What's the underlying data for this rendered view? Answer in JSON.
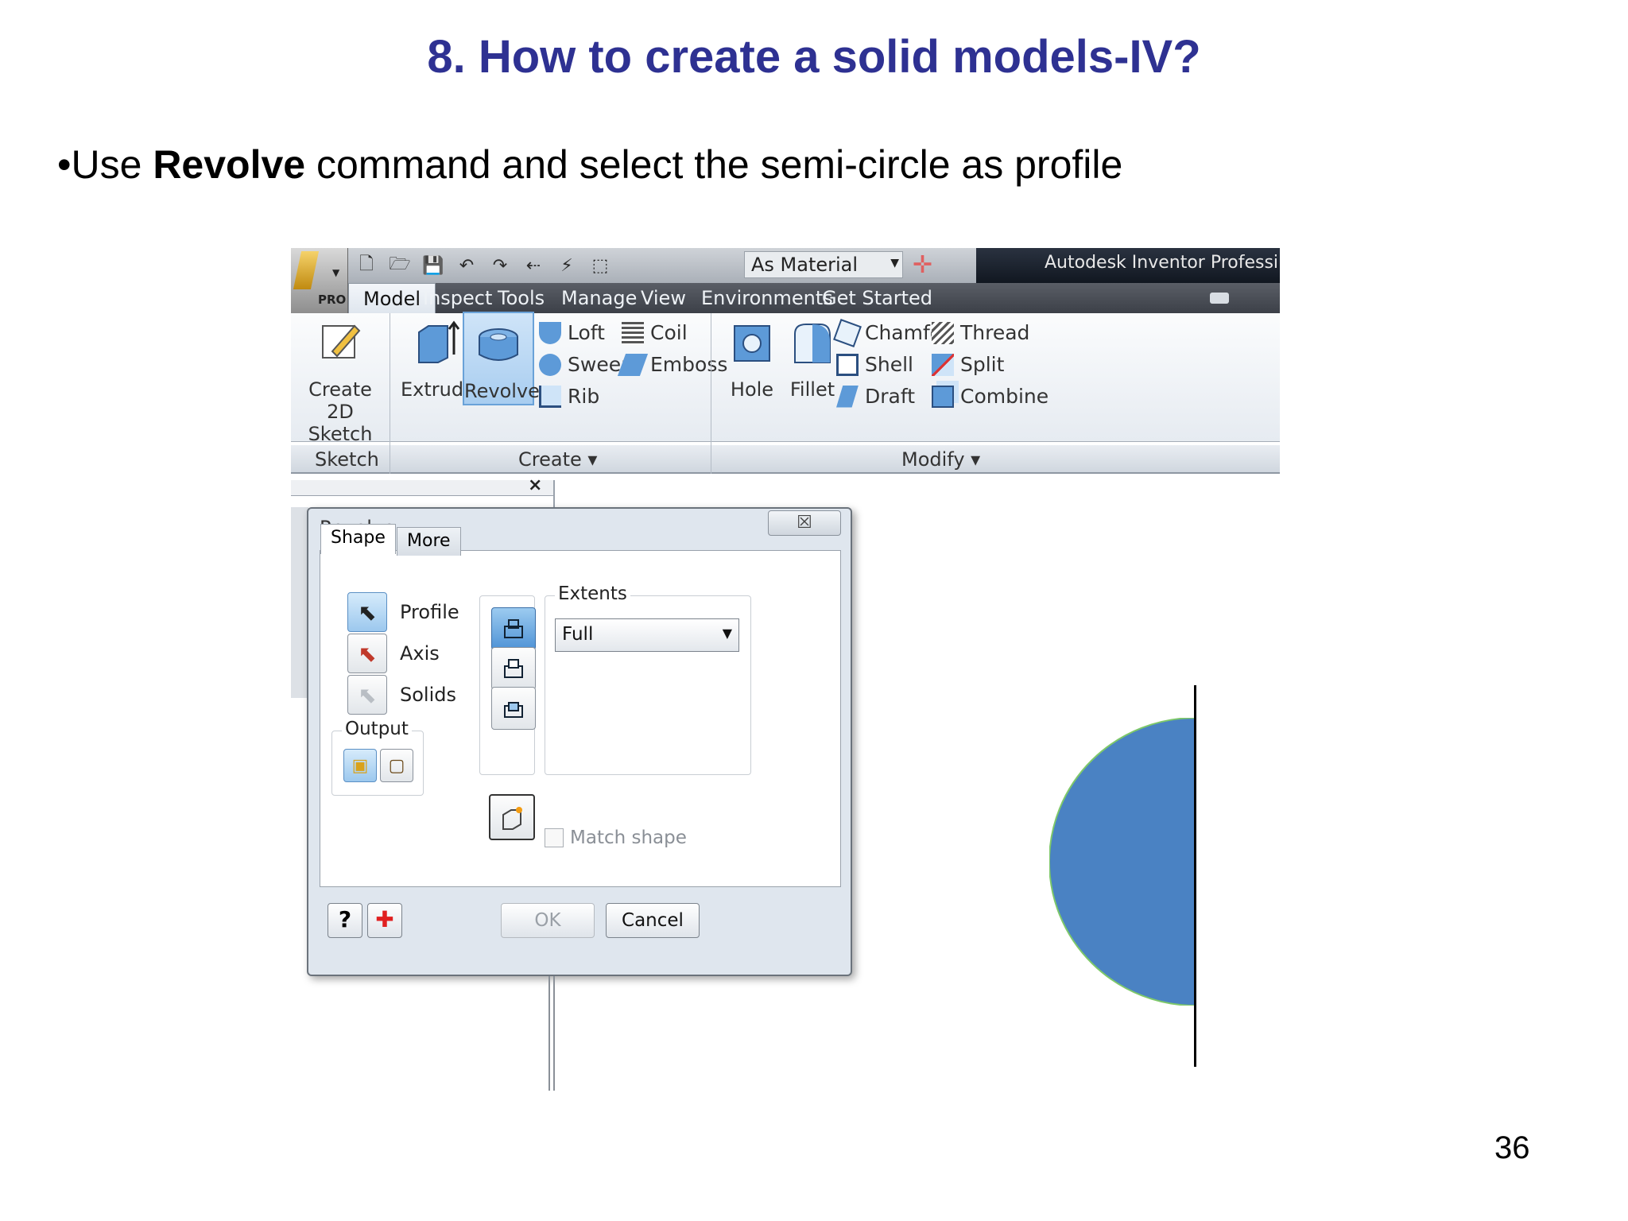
{
  "slide": {
    "title": "8. How to create a solid models-IV?",
    "bullet_prefix": "•Use ",
    "bullet_bold": "Revolve",
    "bullet_rest": " command and select the semi-circle as profile",
    "page_number": "36"
  },
  "app": {
    "badge": "PRO",
    "appearance_value": "As Material",
    "title_text": "Autodesk Inventor Professi",
    "tabs": [
      "Model",
      "Inspect",
      "Tools",
      "Manage",
      "View",
      "Environments",
      "Get Started"
    ],
    "active_tab": "Model"
  },
  "ribbon": {
    "sketch": {
      "line1": "Create",
      "line2": "2D Sketch",
      "panel": "Sketch"
    },
    "create": {
      "extrude": "Extrude",
      "revolve": "Revolve",
      "loft": "Loft",
      "sweep": "Sweep",
      "rib": "Rib",
      "coil": "Coil",
      "emboss": "Emboss",
      "panel": "Create ▾"
    },
    "modify": {
      "hole": "Hole",
      "fillet": "Fillet",
      "chamfer": "Chamfer",
      "shell": "Shell",
      "draft": "Draft",
      "thread": "Thread",
      "split": "Split",
      "combine": "Combine",
      "panel": "Modify ▾"
    }
  },
  "dialog": {
    "title": "Revolve",
    "close_glyph": "☒",
    "tab_shape": "Shape",
    "tab_more": "More",
    "profile": "Profile",
    "axis": "Axis",
    "solids": "Solids",
    "output": "Output",
    "extents": "Extents",
    "extents_value": "Full",
    "match_shape": "Match shape",
    "ok": "OK",
    "cancel": "Cancel",
    "help_glyph": "?",
    "plus_glyph": "✚"
  },
  "colors": {
    "title_blue": "#2e3192",
    "semicircle_fill": "#4a82c3",
    "semicircle_edge": "#7ec86a"
  }
}
